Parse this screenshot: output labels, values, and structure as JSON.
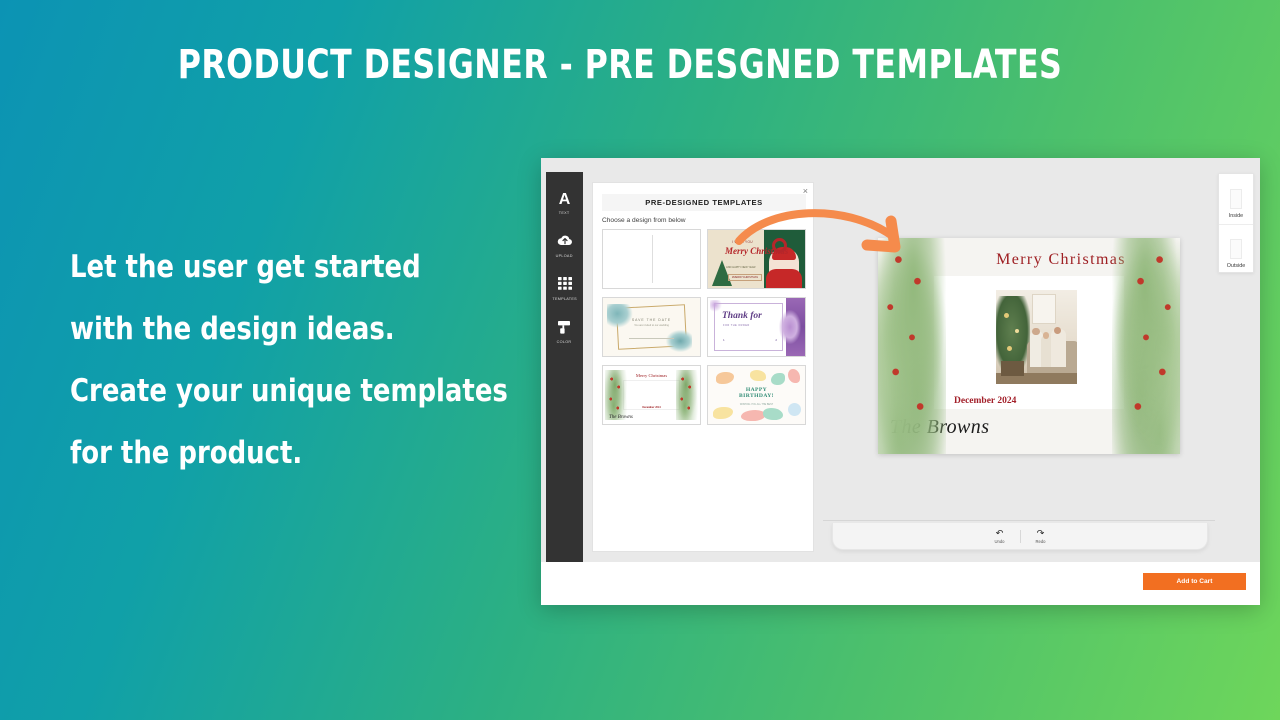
{
  "slide": {
    "headline": "PRODUCT DESIGNER - PRE DESGNED TEMPLATES",
    "body_lines": [
      "Let the user get started",
      "with the design ideas.",
      "Create your unique templates",
      "for the product."
    ],
    "background": {
      "from": "#0c93b4",
      "to": "#6ed65b"
    },
    "accent": "#f26f21"
  },
  "app": {
    "sidebar": {
      "items": [
        {
          "label": "TEXT",
          "icon": "text-icon"
        },
        {
          "label": "UPLOAD",
          "icon": "cloud-upload-icon"
        },
        {
          "label": "TEMPLATES",
          "icon": "grid-icon"
        },
        {
          "label": "COLOR",
          "icon": "paint-roller-icon"
        }
      ]
    },
    "panel": {
      "title": "PRE-DESIGNED TEMPLATES",
      "close_label": "×",
      "subtitle": "Choose a design from below",
      "templates": [
        {
          "name": "blank-card",
          "caption": ""
        },
        {
          "name": "santa-merry-christmas",
          "caption": "I WISH YOU",
          "heading": "Merry Christmas",
          "sub": "AND HAPPY NEW YEAR",
          "tag": "#MERRYCHRISTMAS"
        },
        {
          "name": "save-the-date",
          "heading": "SAVE THE DATE",
          "sub": "You are invited to our wedding"
        },
        {
          "name": "thank-you-lilac",
          "heading": "Thank for",
          "sub": "FOR THE ORDER",
          "col_left": "1",
          "col_right": "2"
        },
        {
          "name": "merry-christmas-holly",
          "heading": "Merry Christmas",
          "date": "December 2024",
          "signature": "The Browns"
        },
        {
          "name": "happy-birthday",
          "heading_line1": "HAPPY",
          "heading_line2": "BIRTHDAY!",
          "sub": "WISHING YOU ALL THE BEST"
        }
      ]
    },
    "canvas": {
      "card": {
        "title": "Merry Christmas",
        "date": "December 2024",
        "signature": "The Browns",
        "title_color": "#9e1f23",
        "date_color": "#a3202a"
      },
      "history": [
        {
          "label": "Undo",
          "icon": "undo-arrow-icon",
          "glyph": "↶"
        },
        {
          "label": "Redo",
          "icon": "redo-arrow-icon",
          "glyph": "↷"
        }
      ]
    },
    "side_toggles": [
      {
        "label": "Inside"
      },
      {
        "label": "Outside"
      }
    ],
    "footer": {
      "add_to_cart": "Add to Cart"
    }
  }
}
